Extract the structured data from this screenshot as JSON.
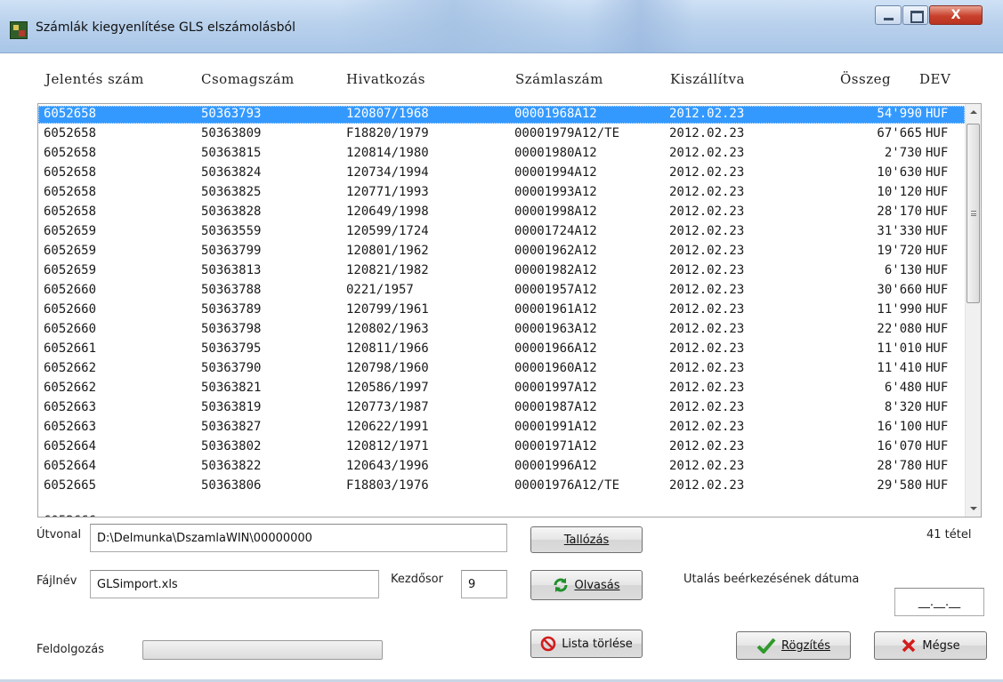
{
  "window": {
    "title": "Számlák kiegyenlítése GLS elszámolásból",
    "close_glyph": "X"
  },
  "columns": [
    "Jelentés szám",
    "Csomagszám",
    "Hivatkozás",
    "Számlaszám",
    "Kiszállítva",
    "Összeg",
    "DEV"
  ],
  "rows": [
    [
      "6052658",
      "50363793",
      "120807/1968",
      "00001968A12",
      "2012.02.23",
      "54'990",
      "HUF"
    ],
    [
      "6052658",
      "50363809",
      "F18820/1979",
      "00001979A12/TE",
      "2012.02.23",
      "67'665",
      "HUF"
    ],
    [
      "6052658",
      "50363815",
      "120814/1980",
      "00001980A12",
      "2012.02.23",
      "2'730",
      "HUF"
    ],
    [
      "6052658",
      "50363824",
      "120734/1994",
      "00001994A12",
      "2012.02.23",
      "10'630",
      "HUF"
    ],
    [
      "6052658",
      "50363825",
      "120771/1993",
      "00001993A12",
      "2012.02.23",
      "10'120",
      "HUF"
    ],
    [
      "6052658",
      "50363828",
      "120649/1998",
      "00001998A12",
      "2012.02.23",
      "28'170",
      "HUF"
    ],
    [
      "6052659",
      "50363559",
      "120599/1724",
      "00001724A12",
      "2012.02.23",
      "31'330",
      "HUF"
    ],
    [
      "6052659",
      "50363799",
      "120801/1962",
      "00001962A12",
      "2012.02.23",
      "19'720",
      "HUF"
    ],
    [
      "6052659",
      "50363813",
      "120821/1982",
      "00001982A12",
      "2012.02.23",
      "6'130",
      "HUF"
    ],
    [
      "6052660",
      "50363788",
      "0221/1957",
      "00001957A12",
      "2012.02.23",
      "30'660",
      "HUF"
    ],
    [
      "6052660",
      "50363789",
      "120799/1961",
      "00001961A12",
      "2012.02.23",
      "11'990",
      "HUF"
    ],
    [
      "6052660",
      "50363798",
      "120802/1963",
      "00001963A12",
      "2012.02.23",
      "22'080",
      "HUF"
    ],
    [
      "6052661",
      "50363795",
      "120811/1966",
      "00001966A12",
      "2012.02.23",
      "11'010",
      "HUF"
    ],
    [
      "6052662",
      "50363790",
      "120798/1960",
      "00001960A12",
      "2012.02.23",
      "11'410",
      "HUF"
    ],
    [
      "6052662",
      "50363821",
      "120586/1997",
      "00001997A12",
      "2012.02.23",
      "6'480",
      "HUF"
    ],
    [
      "6052663",
      "50363819",
      "120773/1987",
      "00001987A12",
      "2012.02.23",
      "8'320",
      "HUF"
    ],
    [
      "6052663",
      "50363827",
      "120622/1991",
      "00001991A12",
      "2012.02.23",
      "16'100",
      "HUF"
    ],
    [
      "6052664",
      "50363802",
      "120812/1971",
      "00001971A12",
      "2012.02.23",
      "16'070",
      "HUF"
    ],
    [
      "6052664",
      "50363822",
      "120643/1996",
      "00001996A12",
      "2012.02.23",
      "28'780",
      "HUF"
    ],
    [
      "6052665",
      "50363806",
      "F18803/1976",
      "00001976A12/TE",
      "2012.02.23",
      "29'580",
      "HUF"
    ]
  ],
  "selected_row": 0,
  "form": {
    "path_label": "Útvonal",
    "path_value": "D:\\Delmunka\\DszamlaWIN\\00000000",
    "browse_label": "Tallózás",
    "item_count": "41 tétel",
    "file_label": "Fájlnév",
    "file_value": "GLSimport.xls",
    "start_row_label": "Kezdősor",
    "start_row_value": "9",
    "read_label": "Olvasás",
    "date_label": "Utalás beérkezésének dátuma",
    "date_value": "__.__.__",
    "progress_label": "Feldolgozás",
    "clear_label": "Lista törlése",
    "save_label": "Rögzítés",
    "cancel_label": "Mégse"
  },
  "colors": {
    "selection": "#3399ff",
    "titlebar": "#b9d1ec",
    "close_button": "#c8412c"
  },
  "icons": {
    "app": "app-icon",
    "refresh": "refresh-icon",
    "clear": "no-entry-icon",
    "save": "checkmark-icon",
    "cancel": "x-icon"
  }
}
